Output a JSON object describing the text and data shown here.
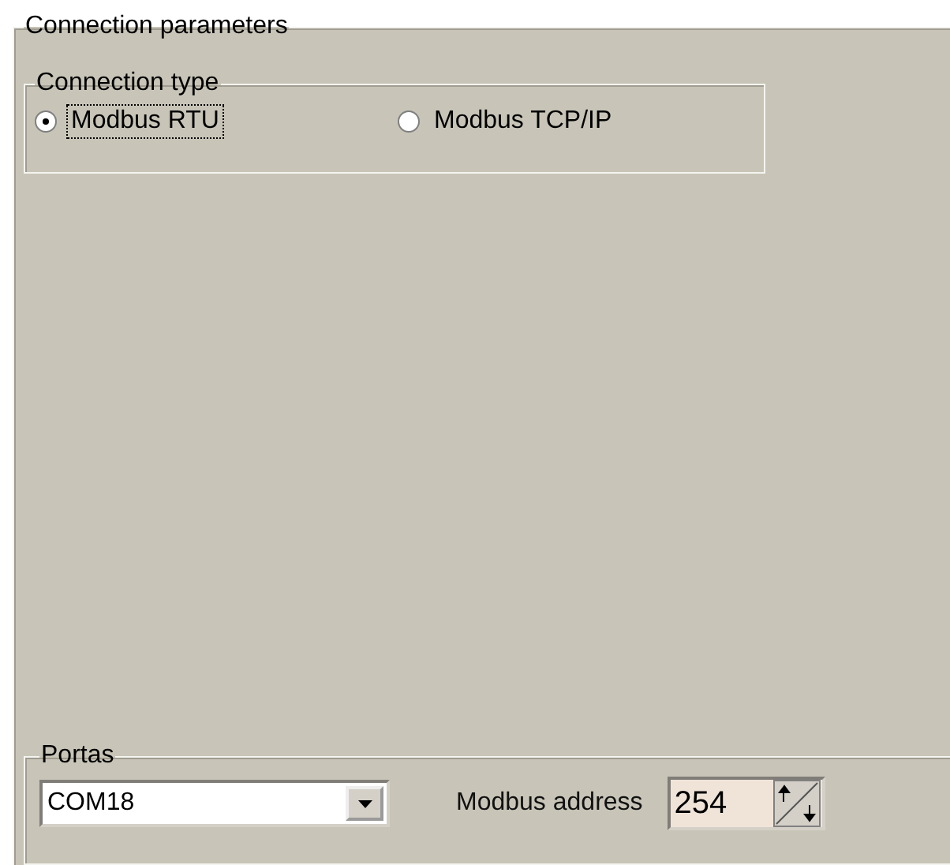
{
  "panel": {
    "title": "Connection parameters"
  },
  "connection_type": {
    "title": "Connection type",
    "options": [
      {
        "label": "Modbus RTU",
        "selected": true
      },
      {
        "label": "Modbus TCP/IP",
        "selected": false
      }
    ]
  },
  "ports": {
    "title": "Portas",
    "port_value": "COM18",
    "address_label": "Modbus address",
    "address_value": "254"
  }
}
